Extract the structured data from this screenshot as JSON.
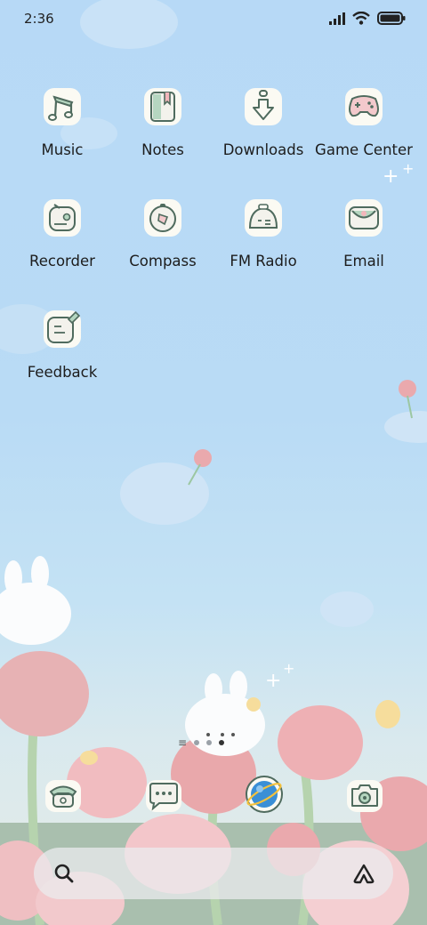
{
  "status_bar": {
    "time": "2:36",
    "icons": [
      "signal-icon",
      "wifi-icon",
      "battery-icon"
    ]
  },
  "apps": [
    {
      "label": "Music",
      "icon": "music-note-icon"
    },
    {
      "label": "Notes",
      "icon": "notebook-icon"
    },
    {
      "label": "Downloads",
      "icon": "download-arrow-icon"
    },
    {
      "label": "Game Center",
      "icon": "gamepad-icon"
    },
    {
      "label": "Recorder",
      "icon": "recorder-icon"
    },
    {
      "label": "Compass",
      "icon": "compass-icon"
    },
    {
      "label": "FM Radio",
      "icon": "radio-icon"
    },
    {
      "label": "Email",
      "icon": "email-icon"
    },
    {
      "label": "Feedback",
      "icon": "feedback-icon"
    }
  ],
  "page_indicator": {
    "pages": 3,
    "current": 2,
    "menu_glyph": "≡"
  },
  "dock": [
    {
      "icon": "phone-icon"
    },
    {
      "icon": "messages-icon"
    },
    {
      "icon": "browser-planet-icon"
    },
    {
      "icon": "camera-icon"
    }
  ],
  "search_bar": {
    "left_icon": "search-icon",
    "right_icon": "assistant-icon"
  },
  "colors": {
    "sky": "#b7d9f6",
    "icon_outline": "#4f6b5e",
    "tulip": "#eaa9ad"
  }
}
